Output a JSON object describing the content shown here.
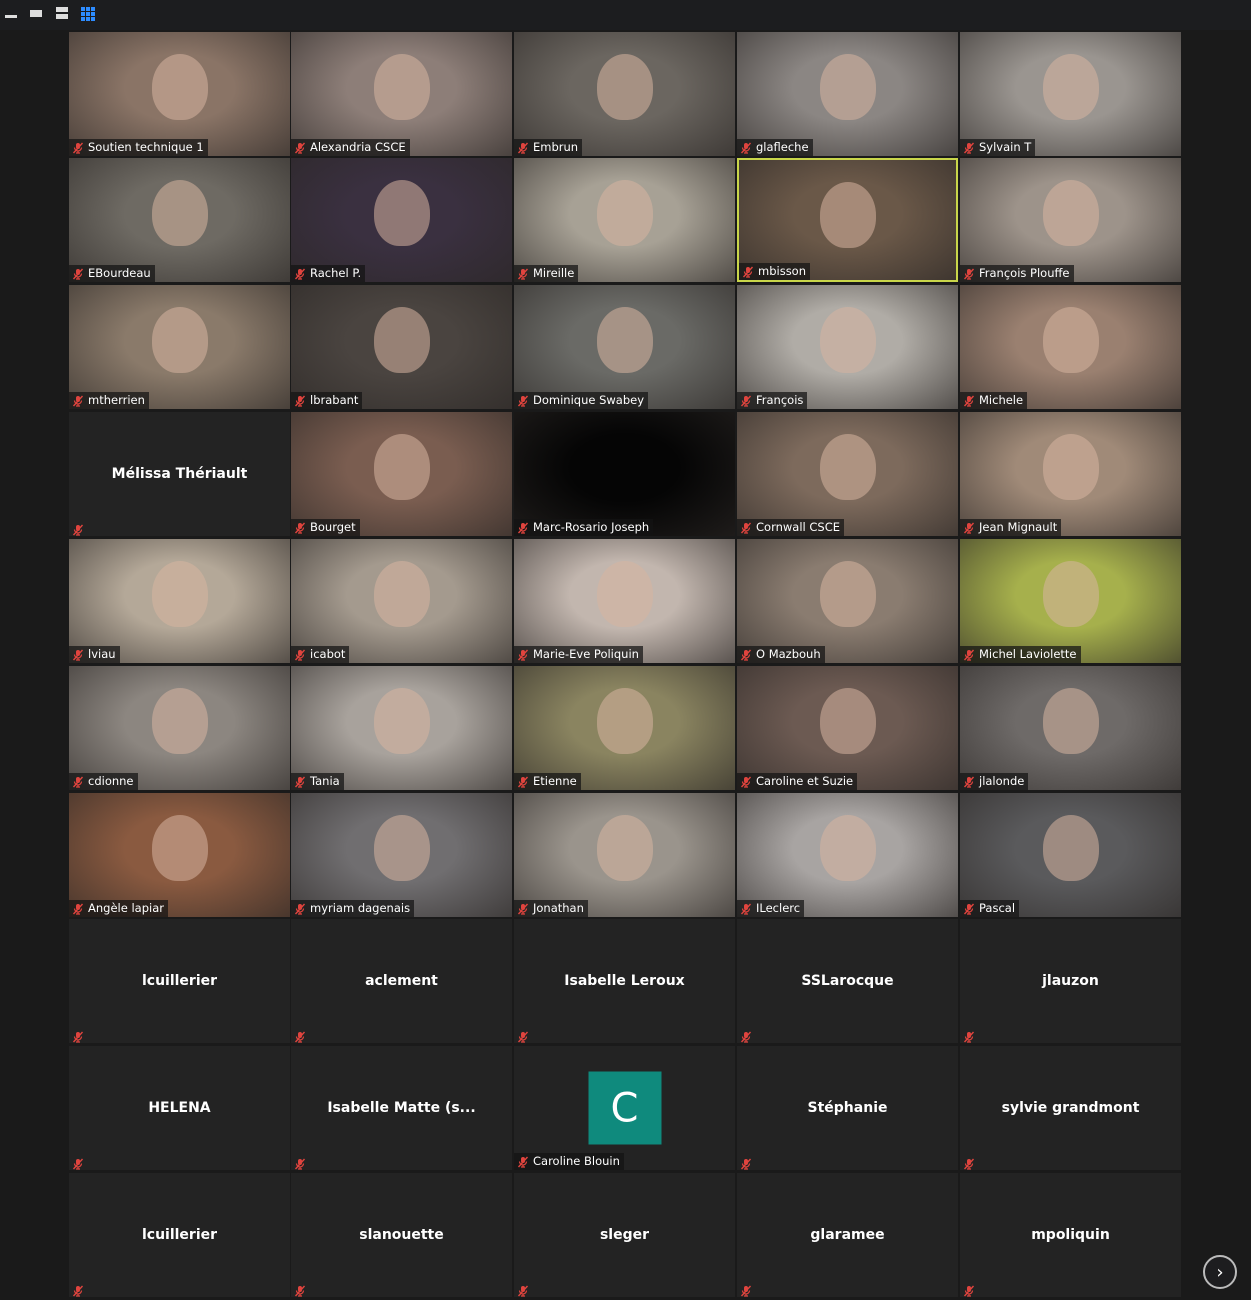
{
  "toolbar": {
    "views": [
      {
        "icon": "minimize-icon"
      },
      {
        "icon": "single-view-icon"
      },
      {
        "icon": "split-view-icon"
      },
      {
        "icon": "gallery-view-icon",
        "active": true
      }
    ]
  },
  "colors": {
    "accent": "#2d8cff",
    "muted_mic": "#e0443e",
    "active_speaker": "#c9d64a",
    "avatar_bg": "#0f8a7d"
  },
  "tiles": [
    {
      "name": "Soutien technique 1",
      "type": "video",
      "bg": "#8a7466"
    },
    {
      "name": "Alexandria CSCE",
      "type": "video",
      "bg": "#8d7e78"
    },
    {
      "name": "Embrun",
      "type": "video",
      "bg": "#6b6660"
    },
    {
      "name": "glafleche",
      "type": "video",
      "bg": "#8b8683"
    },
    {
      "name": "Sylvain T",
      "type": "video",
      "bg": "#9a9590"
    },
    {
      "name": "EBourdeau",
      "type": "video",
      "bg": "#6e6a63"
    },
    {
      "name": "Rachel P.",
      "type": "video",
      "bg": "#3a3040"
    },
    {
      "name": "Mireille",
      "type": "video",
      "bg": "#a7a195"
    },
    {
      "name": "mbisson",
      "type": "video",
      "bg": "#6a5848",
      "active": true
    },
    {
      "name": "François Plouffe",
      "type": "video",
      "bg": "#9d938a"
    },
    {
      "name": "mtherrien",
      "type": "video",
      "bg": "#8a7a6a"
    },
    {
      "name": "lbrabant",
      "type": "video",
      "bg": "#4a4440"
    },
    {
      "name": "Dominique Swabey",
      "type": "video",
      "bg": "#6a6a66"
    },
    {
      "name": "François",
      "type": "video",
      "bg": "#b0aca6"
    },
    {
      "name": "Michele",
      "type": "video",
      "bg": "#9a8070"
    },
    {
      "name": "Mélissa Thériault",
      "type": "name"
    },
    {
      "name": "Bourget",
      "type": "video",
      "bg": "#7a5d50"
    },
    {
      "name": "Marc-Rosario Joseph",
      "type": "video",
      "bg": "#050505"
    },
    {
      "name": "Cornwall CSCE",
      "type": "video",
      "bg": "#7d6a5c"
    },
    {
      "name": "Jean Mignault",
      "type": "video",
      "bg": "#a08a78"
    },
    {
      "name": "lviau",
      "type": "video",
      "bg": "#b4a898"
    },
    {
      "name": "icabot",
      "type": "video",
      "bg": "#a49a8e"
    },
    {
      "name": "Marie-Eve Poliquin",
      "type": "video",
      "bg": "#c2b6ae"
    },
    {
      "name": "O Mazbouh",
      "type": "video",
      "bg": "#8a7c70"
    },
    {
      "name": "Michel Laviolette",
      "type": "video",
      "bg": "#a6b04c"
    },
    {
      "name": "cdionne",
      "type": "video",
      "bg": "#8c8680"
    },
    {
      "name": "Tania",
      "type": "video",
      "bg": "#a8a29c"
    },
    {
      "name": "Etienne",
      "type": "video",
      "bg": "#8a8460"
    },
    {
      "name": "Caroline et Suzie",
      "type": "video",
      "bg": "#6c5a52"
    },
    {
      "name": "jlalonde",
      "type": "video",
      "bg": "#6e6a68"
    },
    {
      "name": "Angèle lapiar",
      "type": "video",
      "bg": "#8a5a40"
    },
    {
      "name": "myriam dagenais",
      "type": "video",
      "bg": "#706e70"
    },
    {
      "name": "Jonathan",
      "type": "video",
      "bg": "#9a948c"
    },
    {
      "name": "ILeclerc",
      "type": "video",
      "bg": "#a8a4a2"
    },
    {
      "name": "Pascal",
      "type": "video",
      "bg": "#5a5a5c"
    },
    {
      "name": "lcuillerier",
      "type": "name"
    },
    {
      "name": "aclement",
      "type": "name"
    },
    {
      "name": "Isabelle Leroux",
      "type": "name"
    },
    {
      "name": "SSLarocque",
      "type": "name"
    },
    {
      "name": "jlauzon",
      "type": "name"
    },
    {
      "name": "HELENA",
      "type": "name"
    },
    {
      "name": "Isabelle Matte (s...",
      "type": "name"
    },
    {
      "name": "Caroline Blouin",
      "type": "avatar",
      "initial": "C"
    },
    {
      "name": "Stéphanie",
      "type": "name"
    },
    {
      "name": "sylvie grandmont",
      "type": "name"
    },
    {
      "name": "lcuillerier",
      "type": "name"
    },
    {
      "name": "slanouette",
      "type": "name"
    },
    {
      "name": "sleger",
      "type": "name"
    },
    {
      "name": "glaramee",
      "type": "name"
    },
    {
      "name": "mpoliquin",
      "type": "name"
    }
  ],
  "pager": {
    "icon": "chevron-right-icon",
    "glyph": "›"
  }
}
